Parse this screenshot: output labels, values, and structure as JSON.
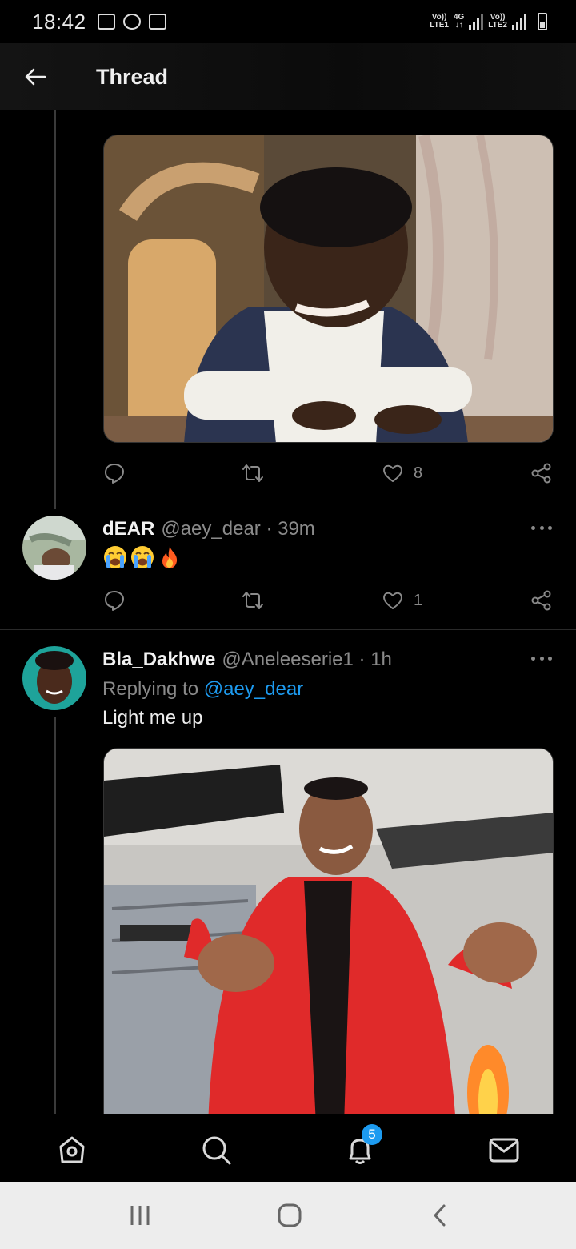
{
  "status_bar": {
    "time": "18:42",
    "net1_top": "Vo))",
    "net1_bottom": "LTE1",
    "net_type_top": "4G",
    "net_type_bottom": "↓↑",
    "net2_top": "Vo))",
    "net2_bottom": "LTE2",
    "icons": [
      "gallery-icon",
      "app-icon",
      "media-icon",
      "signal-icon",
      "battery-icon"
    ]
  },
  "header": {
    "title": "Thread",
    "back_icon": "arrow-left-icon"
  },
  "tweet1": {
    "like_count": "8",
    "image_description_icon": "photo"
  },
  "tweet2": {
    "name": "dEAR",
    "handle": "@aey_dear · 39m",
    "emojis": [
      "loudly-crying-face",
      "loudly-crying-face",
      "fire"
    ],
    "like_count": "1"
  },
  "tweet3": {
    "name": "Bla_Dakhwe",
    "handle": "@Aneleeserie1 · 1h",
    "replying_prefix": "Replying to ",
    "replying_handle": "@aey_dear",
    "text": "Light me up"
  },
  "bottom_nav": {
    "items": [
      "home-icon",
      "search-icon",
      "notifications-icon",
      "messages-icon"
    ],
    "notification_badge": "5",
    "accent": "#1d9bf0"
  },
  "system_nav": [
    "recents-icon",
    "home-button-icon",
    "back-icon"
  ]
}
